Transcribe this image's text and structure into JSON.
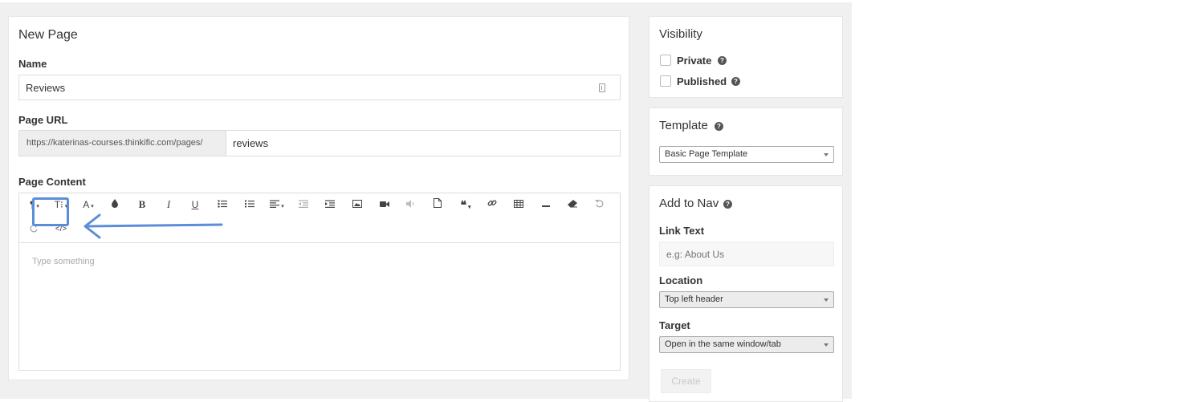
{
  "main": {
    "title": "New Page",
    "name_label": "Name",
    "name_value": "Reviews",
    "url_label": "Page URL",
    "url_prefix": "https://katerinas-courses.thinkific.com/pages/",
    "url_slug": "reviews",
    "content_label": "Page Content",
    "editor_placeholder": "Type something",
    "toolbar": {
      "paragraph": "¶",
      "font_size": "T⁝",
      "font_color": "A",
      "bold": "B",
      "italic": "I",
      "underline": "U",
      "code_view": "</>"
    }
  },
  "visibility": {
    "title": "Visibility",
    "private_label": "Private",
    "published_label": "Published",
    "private_checked": false,
    "published_checked": false
  },
  "template": {
    "title": "Template",
    "selected": "Basic Page Template"
  },
  "nav": {
    "title": "Add to Nav",
    "link_text_label": "Link Text",
    "link_text_placeholder": "e.g: About Us",
    "location_label": "Location",
    "location_selected": "Top left header",
    "target_label": "Target",
    "target_selected": "Open in the same window/tab",
    "create_label": "Create"
  },
  "colors": {
    "highlight": "#5b8ed8",
    "background": "#f0f0f0"
  }
}
